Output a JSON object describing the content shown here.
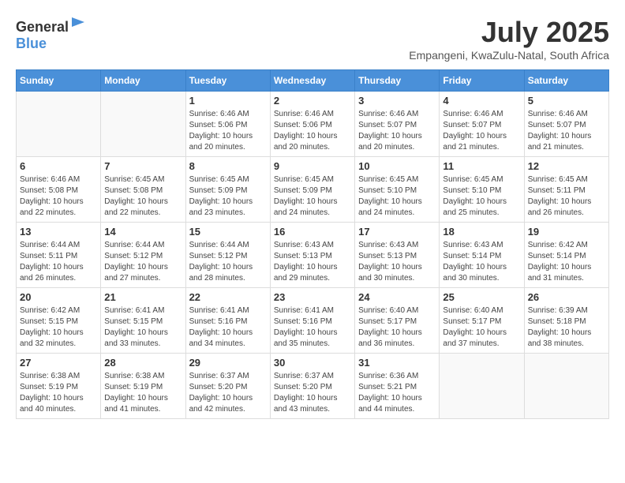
{
  "header": {
    "logo_general": "General",
    "logo_blue": "Blue",
    "month_year": "July 2025",
    "location": "Empangeni, KwaZulu-Natal, South Africa"
  },
  "weekdays": [
    "Sunday",
    "Monday",
    "Tuesday",
    "Wednesday",
    "Thursday",
    "Friday",
    "Saturday"
  ],
  "weeks": [
    [
      {
        "day": "",
        "empty": true
      },
      {
        "day": "",
        "empty": true
      },
      {
        "day": "1",
        "sunrise": "6:46 AM",
        "sunset": "5:06 PM",
        "daylight": "10 hours and 20 minutes."
      },
      {
        "day": "2",
        "sunrise": "6:46 AM",
        "sunset": "5:06 PM",
        "daylight": "10 hours and 20 minutes."
      },
      {
        "day": "3",
        "sunrise": "6:46 AM",
        "sunset": "5:07 PM",
        "daylight": "10 hours and 20 minutes."
      },
      {
        "day": "4",
        "sunrise": "6:46 AM",
        "sunset": "5:07 PM",
        "daylight": "10 hours and 21 minutes."
      },
      {
        "day": "5",
        "sunrise": "6:46 AM",
        "sunset": "5:07 PM",
        "daylight": "10 hours and 21 minutes."
      }
    ],
    [
      {
        "day": "6",
        "sunrise": "6:46 AM",
        "sunset": "5:08 PM",
        "daylight": "10 hours and 22 minutes."
      },
      {
        "day": "7",
        "sunrise": "6:45 AM",
        "sunset": "5:08 PM",
        "daylight": "10 hours and 22 minutes."
      },
      {
        "day": "8",
        "sunrise": "6:45 AM",
        "sunset": "5:09 PM",
        "daylight": "10 hours and 23 minutes."
      },
      {
        "day": "9",
        "sunrise": "6:45 AM",
        "sunset": "5:09 PM",
        "daylight": "10 hours and 24 minutes."
      },
      {
        "day": "10",
        "sunrise": "6:45 AM",
        "sunset": "5:10 PM",
        "daylight": "10 hours and 24 minutes."
      },
      {
        "day": "11",
        "sunrise": "6:45 AM",
        "sunset": "5:10 PM",
        "daylight": "10 hours and 25 minutes."
      },
      {
        "day": "12",
        "sunrise": "6:45 AM",
        "sunset": "5:11 PM",
        "daylight": "10 hours and 26 minutes."
      }
    ],
    [
      {
        "day": "13",
        "sunrise": "6:44 AM",
        "sunset": "5:11 PM",
        "daylight": "10 hours and 26 minutes."
      },
      {
        "day": "14",
        "sunrise": "6:44 AM",
        "sunset": "5:12 PM",
        "daylight": "10 hours and 27 minutes."
      },
      {
        "day": "15",
        "sunrise": "6:44 AM",
        "sunset": "5:12 PM",
        "daylight": "10 hours and 28 minutes."
      },
      {
        "day": "16",
        "sunrise": "6:43 AM",
        "sunset": "5:13 PM",
        "daylight": "10 hours and 29 minutes."
      },
      {
        "day": "17",
        "sunrise": "6:43 AM",
        "sunset": "5:13 PM",
        "daylight": "10 hours and 30 minutes."
      },
      {
        "day": "18",
        "sunrise": "6:43 AM",
        "sunset": "5:14 PM",
        "daylight": "10 hours and 30 minutes."
      },
      {
        "day": "19",
        "sunrise": "6:42 AM",
        "sunset": "5:14 PM",
        "daylight": "10 hours and 31 minutes."
      }
    ],
    [
      {
        "day": "20",
        "sunrise": "6:42 AM",
        "sunset": "5:15 PM",
        "daylight": "10 hours and 32 minutes."
      },
      {
        "day": "21",
        "sunrise": "6:41 AM",
        "sunset": "5:15 PM",
        "daylight": "10 hours and 33 minutes."
      },
      {
        "day": "22",
        "sunrise": "6:41 AM",
        "sunset": "5:16 PM",
        "daylight": "10 hours and 34 minutes."
      },
      {
        "day": "23",
        "sunrise": "6:41 AM",
        "sunset": "5:16 PM",
        "daylight": "10 hours and 35 minutes."
      },
      {
        "day": "24",
        "sunrise": "6:40 AM",
        "sunset": "5:17 PM",
        "daylight": "10 hours and 36 minutes."
      },
      {
        "day": "25",
        "sunrise": "6:40 AM",
        "sunset": "5:17 PM",
        "daylight": "10 hours and 37 minutes."
      },
      {
        "day": "26",
        "sunrise": "6:39 AM",
        "sunset": "5:18 PM",
        "daylight": "10 hours and 38 minutes."
      }
    ],
    [
      {
        "day": "27",
        "sunrise": "6:38 AM",
        "sunset": "5:19 PM",
        "daylight": "10 hours and 40 minutes."
      },
      {
        "day": "28",
        "sunrise": "6:38 AM",
        "sunset": "5:19 PM",
        "daylight": "10 hours and 41 minutes."
      },
      {
        "day": "29",
        "sunrise": "6:37 AM",
        "sunset": "5:20 PM",
        "daylight": "10 hours and 42 minutes."
      },
      {
        "day": "30",
        "sunrise": "6:37 AM",
        "sunset": "5:20 PM",
        "daylight": "10 hours and 43 minutes."
      },
      {
        "day": "31",
        "sunrise": "6:36 AM",
        "sunset": "5:21 PM",
        "daylight": "10 hours and 44 minutes."
      },
      {
        "day": "",
        "empty": true
      },
      {
        "day": "",
        "empty": true
      }
    ]
  ]
}
